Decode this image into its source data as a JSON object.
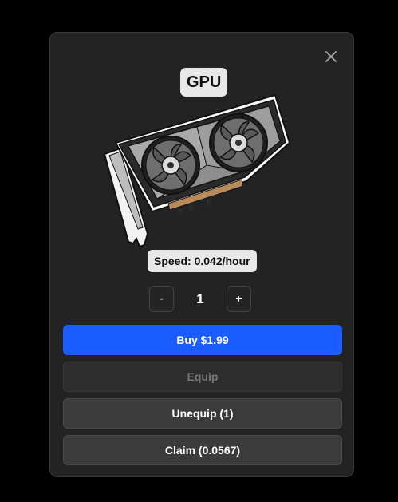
{
  "modal": {
    "title": "GPU",
    "item_image": "gpu-graphics-card-icon",
    "close_icon": "close-icon",
    "speed_label": "Speed: 0.042/hour",
    "quantity": {
      "minus_label": "-",
      "value": "1",
      "plus_label": "+"
    },
    "buttons": {
      "buy_label": "Buy $1.99",
      "equip_label": "Equip",
      "unequip_label": "Unequip (1)",
      "claim_label": "Claim (0.0567)"
    },
    "colors": {
      "background": "#232323",
      "buy_button": "#1a5cff",
      "disabled_button": "#2d2d2d",
      "secondary_button": "#3b3b3b",
      "chip": "#e8e8e8"
    }
  }
}
